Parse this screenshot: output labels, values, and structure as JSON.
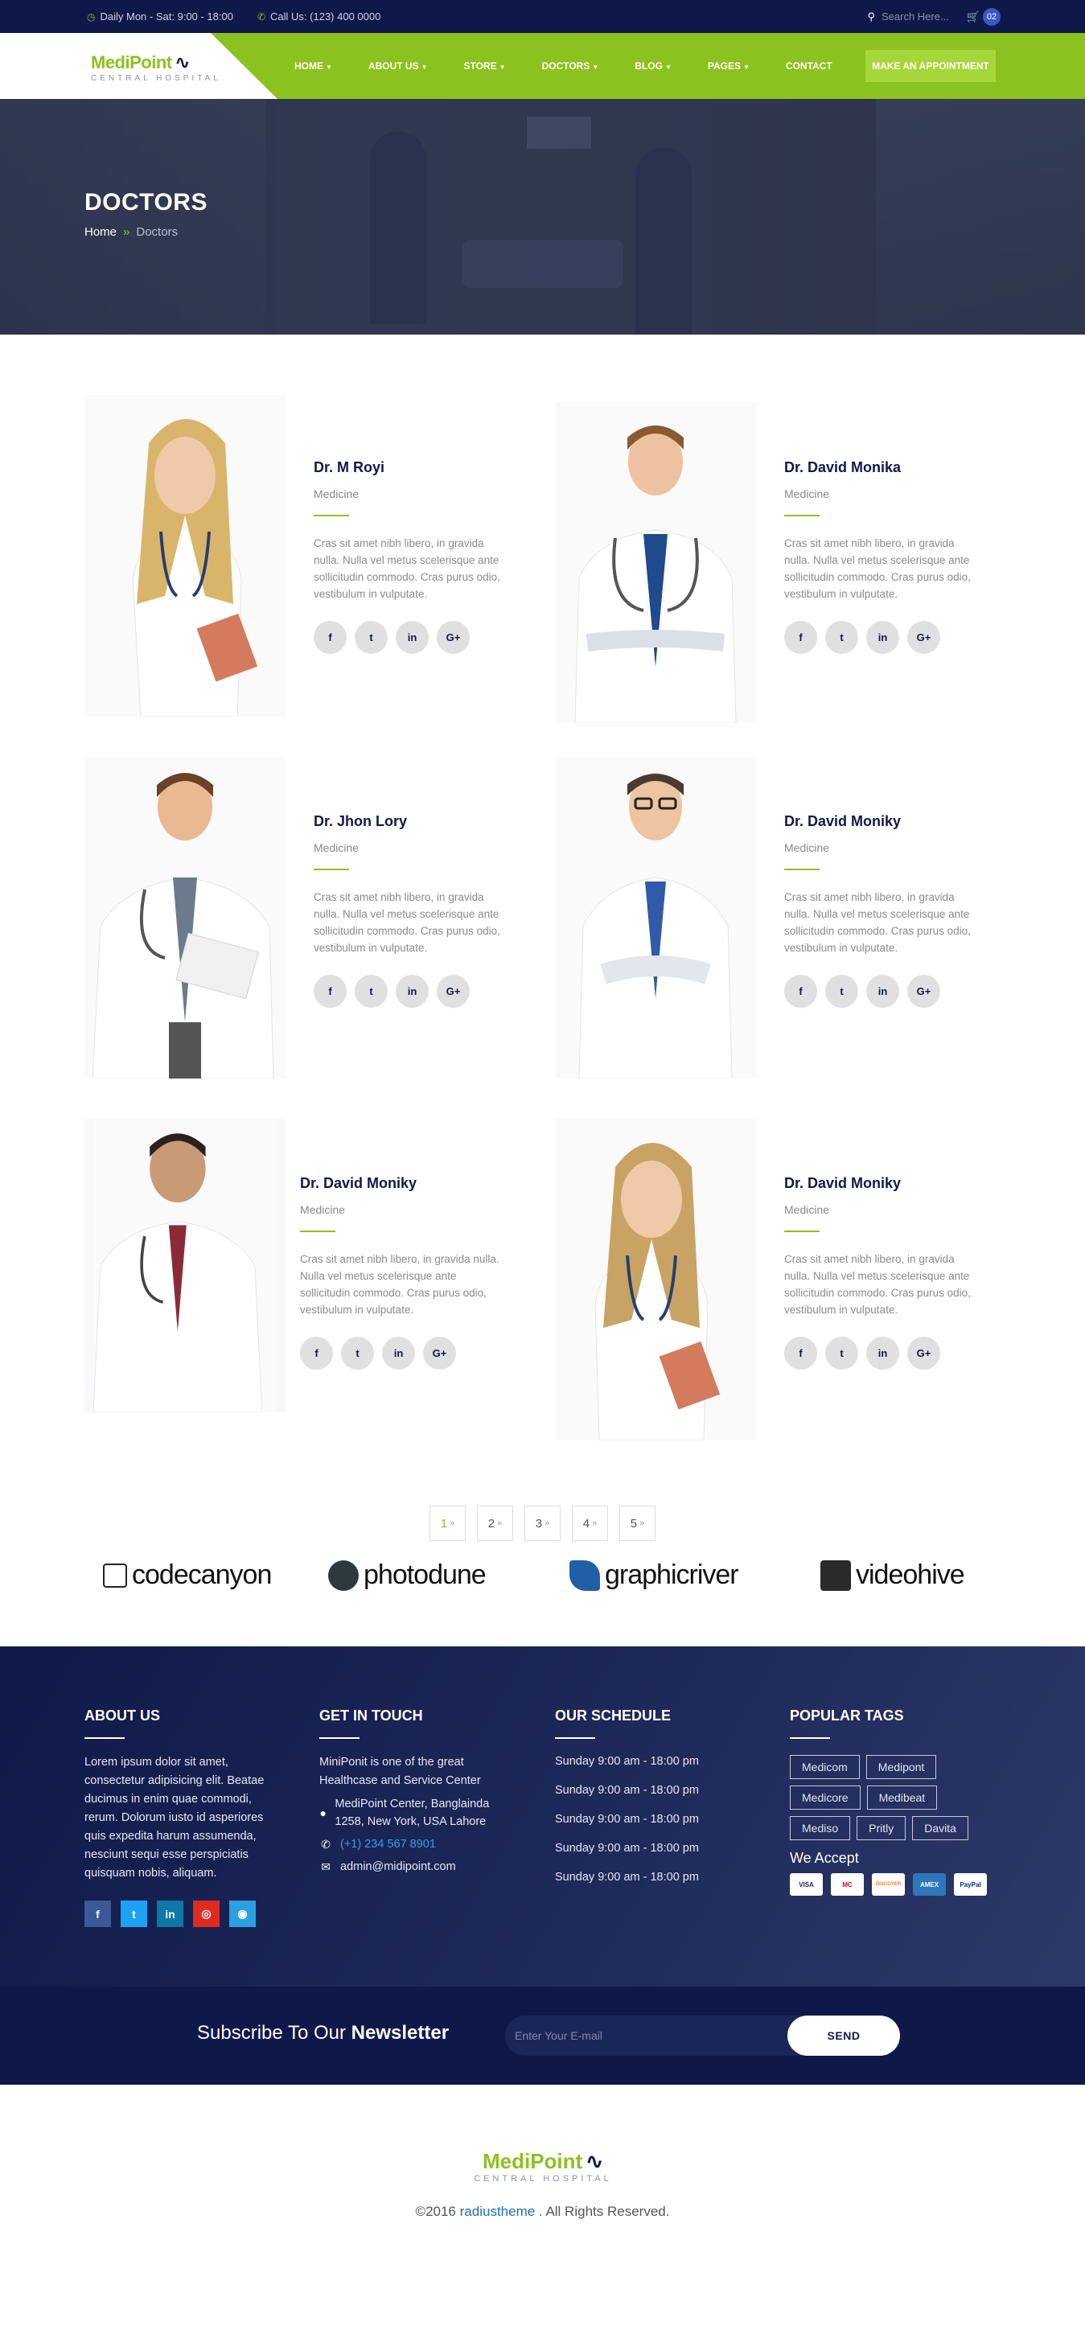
{
  "topbar": {
    "hours": "Daily Mon - Sat: 9:00 - 18:00",
    "phone": "Call Us: (123) 400 0000",
    "search_placeholder": "Search Here...",
    "cart_count": "02",
    "icons": {
      "hours": "clock-icon",
      "phone": "phone-icon",
      "search": "search-icon",
      "cart": "cart-icon"
    }
  },
  "header": {
    "logo_name": "MediPoint",
    "logo_sub": "CENTRAL HOSPITAL",
    "nav": [
      {
        "label": "HOME",
        "dropdown": true
      },
      {
        "label": "ABOUT US",
        "dropdown": true
      },
      {
        "label": "STORE",
        "dropdown": true
      },
      {
        "label": "DOCTORS",
        "dropdown": true
      },
      {
        "label": "BLOG",
        "dropdown": true
      },
      {
        "label": "PAGES",
        "dropdown": true
      },
      {
        "label": "CONTACT",
        "dropdown": false
      }
    ],
    "cta": "MAKE AN APPOINTMENT",
    "colors": {
      "brand_green": "#8cc21f",
      "navy": "#0f1949"
    }
  },
  "banner": {
    "title": "DOCTORS",
    "breadcrumb": {
      "home": "Home",
      "separator": "»",
      "current": "Doctors"
    }
  },
  "doctors": [
    {
      "name": "Dr. M Royi",
      "dept": "Medicine",
      "bio": "Cras sit amet nibh libero, in gravida nulla. Nulla vel metus scelerisque ante sollicitudin commodo. Cras purus odio, vestibulum in vulputate.",
      "photo": "female-doctor-photo"
    },
    {
      "name": "Dr. David Monika",
      "dept": "Medicine",
      "bio": "Cras sit amet nibh libero, in gravida nulla. Nulla vel metus scelerisque ante sollicitudin commodo. Cras purus odio, vestibulum in vulputate.",
      "photo": "male-doctor-photo"
    },
    {
      "name": "Dr. Jhon Lory",
      "dept": "Medicine",
      "bio": "Cras sit amet nibh libero, in gravida nulla. Nulla vel metus scelerisque ante sollicitudin commodo. Cras purus odio, vestibulum in vulputate.",
      "photo": "male-doctor-clipboard-photo"
    },
    {
      "name": "Dr. David Moniky",
      "dept": "Medicine",
      "bio": "Cras sit amet nibh libero, in gravida nulla. Nulla vel metus scelerisque ante sollicitudin commodo. Cras purus odio, vestibulum in vulputate.",
      "photo": "male-doctor-glasses-photo"
    },
    {
      "name": "Dr. David Moniky",
      "dept": "Medicine",
      "bio": "Cras sit amet nibh libero, in gravida nulla. Nulla vel metus scelerisque ante sollicitudin commodo. Cras purus odio, vestibulum in vulputate.",
      "photo": "male-doctor-tie-photo"
    },
    {
      "name": "Dr. David Moniky",
      "dept": "Medicine",
      "bio": "Cras sit amet nibh libero, in gravida nulla. Nulla vel metus scelerisque ante sollicitudin commodo. Cras purus odio, vestibulum in vulputate.",
      "photo": "female-doctor-photo"
    }
  ],
  "social_labels": {
    "facebook": "f",
    "twitter": "t",
    "linkedin": "in",
    "google": "G+"
  },
  "pagination": {
    "pages": [
      "1",
      "2",
      "3",
      "4",
      "5"
    ],
    "active": "1",
    "arrow": "»"
  },
  "brands": [
    "codecanyon",
    "photodune",
    "graphicriver",
    "videohive"
  ],
  "footer": {
    "about": {
      "title": "ABOUT US",
      "text": "Lorem ipsum dolor sit amet, consectetur adipisicing elit. Beatae ducimus in enim quae commodi, rerum. Dolorum iusto id asperiores quis expedita harum assumenda, nesciunt sequi esse perspiciatis quisquam nobis, aliquam."
    },
    "touch": {
      "title": "GET IN TOUCH",
      "intro": "MiniPonit is one of the great Healthcase and Service Center",
      "address": "MediPoint Center, Banglainda 1258, New York, USA Lahore",
      "phone": "(+1) 234 567 8901",
      "email": "admin@midipoint.com"
    },
    "schedule": {
      "title": "OUR SCHEDULE",
      "rows": [
        "Sunday 9:00 am - 18:00 pm",
        "Sunday 9:00 am - 18:00 pm",
        "Sunday 9:00 am - 18:00 pm",
        "Sunday 9:00 am - 18:00 pm",
        "Sunday 9:00 am - 18:00 pm"
      ]
    },
    "tags": {
      "title": "POPULAR TAGS",
      "items": [
        "Medicom",
        "Medipont",
        "Medicore",
        "Medibeat",
        "Mediso",
        "Pritly",
        "Davita"
      ],
      "accept": "We Accept",
      "cards": [
        "VISA",
        "MC",
        "DISCOVER",
        "AMEX",
        "PayPal"
      ]
    }
  },
  "newsletter": {
    "title_plain": "Subscribe To Our",
    "title_bold": "Newsletter",
    "placeholder": "Enter Your E-mail",
    "button": "SEND"
  },
  "bottom": {
    "logo_name": "MediPoint",
    "logo_sub": "CENTRAL HOSPITAL",
    "copy_prefix": "©2016",
    "copy_brand": "radiustheme",
    "copy_suffix": ". All Rights Reserved."
  }
}
